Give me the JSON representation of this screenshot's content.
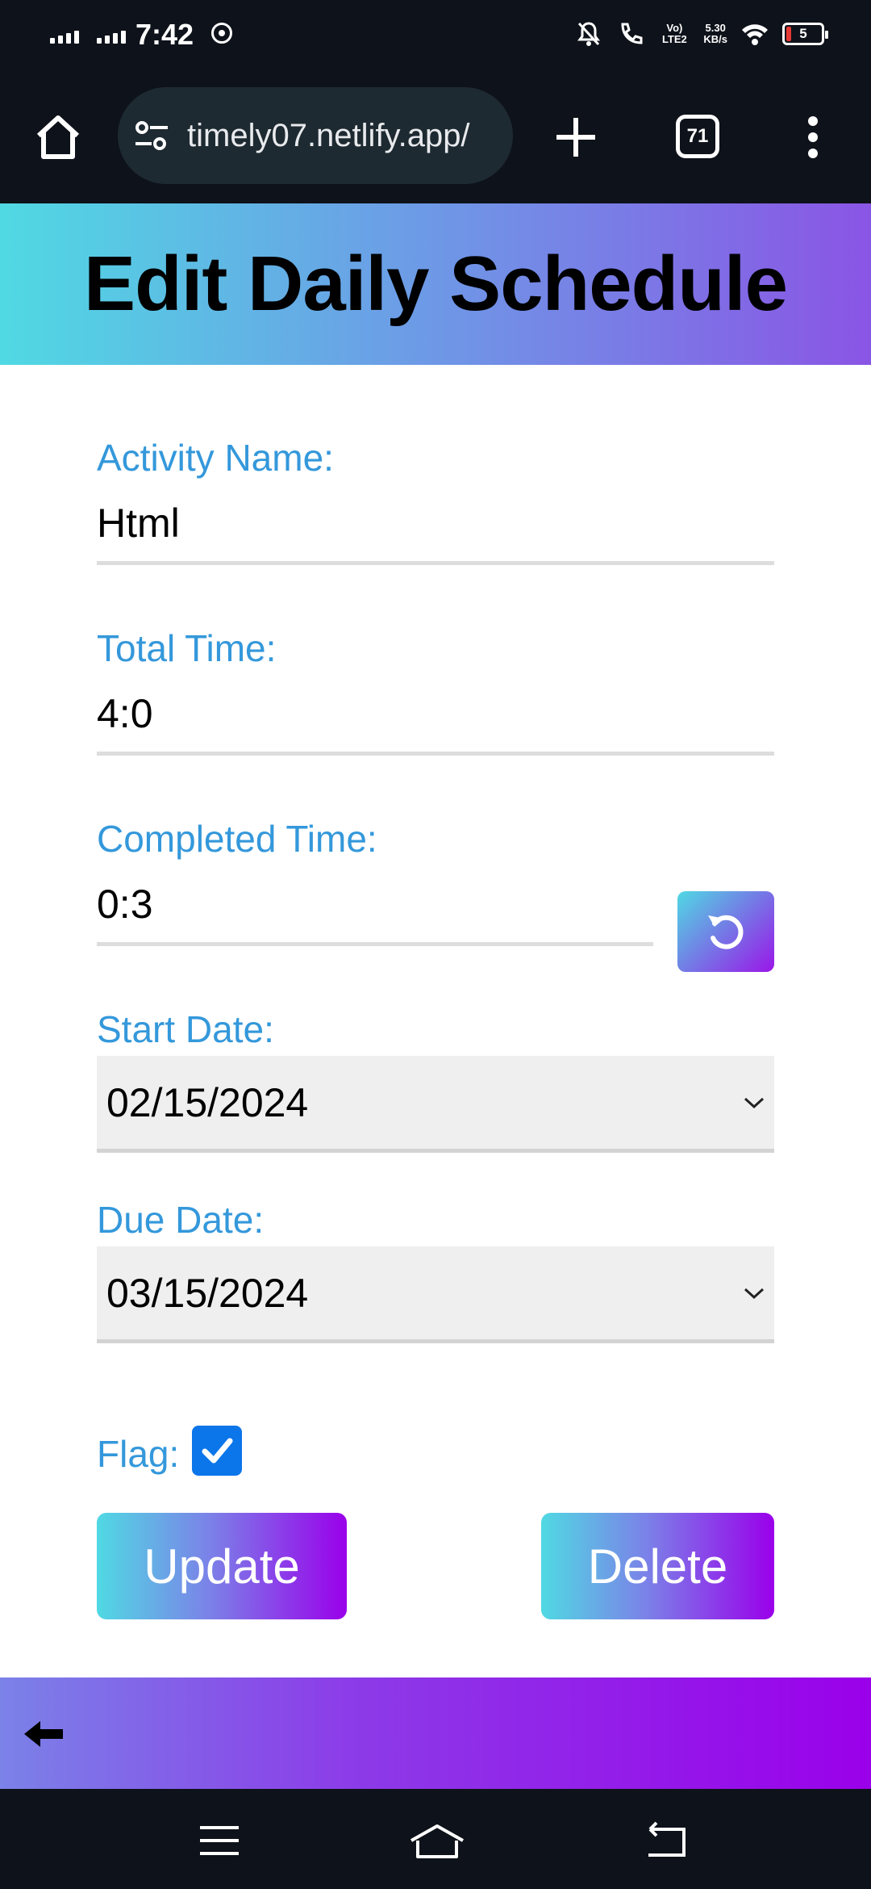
{
  "status_bar": {
    "time": "7:42",
    "network_speed_value": "5.30",
    "network_speed_unit": "KB/s",
    "volte_label": "Vo) LTE2",
    "battery_level": "5",
    "colors": {
      "battery_low": "#e53935"
    }
  },
  "browser": {
    "url": "timely07.netlify.app/",
    "tab_count": "71",
    "icons": [
      "home-icon",
      "site-settings-icon",
      "new-tab-icon",
      "tab-switcher-icon",
      "more-menu-icon"
    ]
  },
  "header": {
    "title": "Edit Daily Schedule",
    "colors": {
      "gradient_start": "#50d9e3",
      "gradient_end": "#8a55e5"
    }
  },
  "form": {
    "activity_name": {
      "label": "Activity Name:",
      "value": "Html"
    },
    "total_time": {
      "label": "Total Time:",
      "value": "4:0"
    },
    "completed_time": {
      "label": "Completed Time:",
      "value": "0:3",
      "reset_icon": "reset-icon"
    },
    "start_date": {
      "label": "Start Date:",
      "value": "02/15/2024"
    },
    "due_date": {
      "label": "Due Date:",
      "value": "03/15/2024"
    },
    "flag": {
      "label": "Flag:",
      "checked": true
    },
    "update_label": "Update",
    "delete_label": "Delete",
    "colors": {
      "label": "#3498db",
      "checkbox": "#0b75ea",
      "button_end": "#9a00ea"
    }
  },
  "footer": {
    "back_icon": "back-arrow-icon"
  },
  "nav_bar": {
    "icons": [
      "recents-menu-icon",
      "home-nav-icon",
      "back-nav-icon"
    ]
  }
}
